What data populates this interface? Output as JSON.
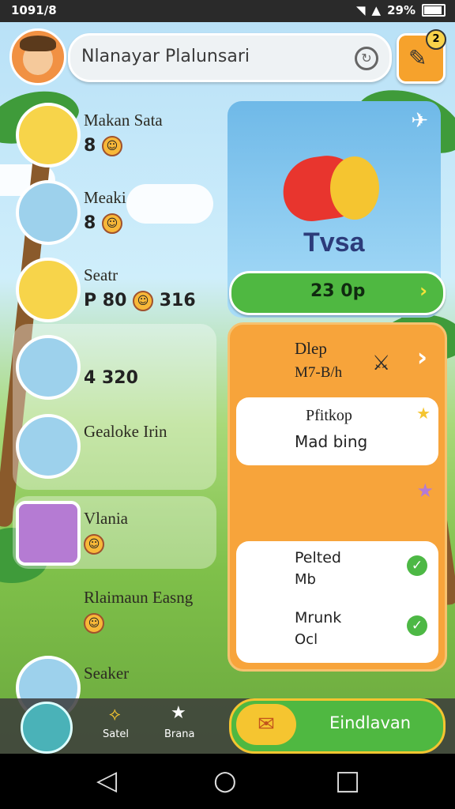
{
  "status": {
    "time": "1091/8",
    "battery": "29%"
  },
  "search": {
    "placeholder": "Nlanayar Plalunsari"
  },
  "edit": {
    "badge": "2"
  },
  "contacts": [
    {
      "name": "Makan Sata",
      "stats": "8",
      "accent": "#f7d44a"
    },
    {
      "name": "Meaki",
      "stats": "8",
      "accent": "#1f6a8c"
    },
    {
      "name": "Seatr",
      "stats": "P 80",
      "extra": "316",
      "accent": "#f7d44a"
    },
    {
      "name": "",
      "stats": "4 320",
      "accent": "#1f6a8c"
    },
    {
      "name": "Gealoke Irin",
      "stats": "",
      "accent": "#1f6a8c"
    },
    {
      "name": "Vlania",
      "stats": "",
      "accent": "#9b59b6"
    },
    {
      "name": "Rlaimaun Easng",
      "stats": "",
      "accent": "#6aa83d"
    },
    {
      "name": "Seaker",
      "stats": "",
      "accent": "#1f6a8c"
    }
  ],
  "featured": {
    "title": "Tvsa",
    "button": "23 0p"
  },
  "panel": {
    "title": "Dlep",
    "subtitle": "M7-B/h",
    "items": [
      {
        "title": "Pfitkop",
        "subtitle": "Mad bing"
      },
      {
        "title": "Pelted",
        "subtitle": "Mb"
      },
      {
        "title": "Mrunk",
        "subtitle": "Ocl"
      }
    ]
  },
  "bottom": {
    "tab1": "Satel",
    "tab2": "Brana",
    "send": "Eindlavan"
  }
}
